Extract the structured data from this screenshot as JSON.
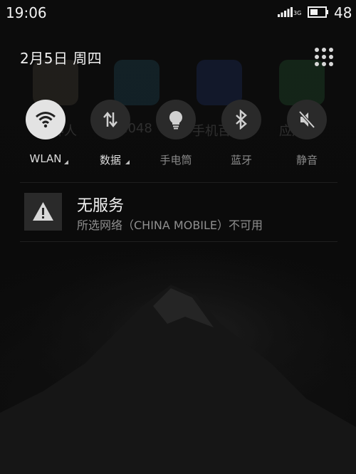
{
  "status_bar": {
    "time": "19:06",
    "network_type": "3G",
    "battery_level": "48"
  },
  "header": {
    "date": "2月5日  周四",
    "grid_icon": "app-grid-icon"
  },
  "background_apps": [
    {
      "label": "神人",
      "color": "#8a7a6a"
    },
    {
      "label": "2048",
      "color": "#3b8db0"
    },
    {
      "label": "手机百度",
      "color": "#2f54c8"
    },
    {
      "label": "应用宝",
      "color": "#3ea65a"
    }
  ],
  "toggles": [
    {
      "label": "WLAN",
      "icon": "wifi-icon",
      "state": "on",
      "has_menu": true
    },
    {
      "label": "数据",
      "icon": "data-arrows-icon",
      "state": "off",
      "has_menu": true
    },
    {
      "label": "手电筒",
      "icon": "flashlight-bulb-icon",
      "state": "off",
      "has_menu": false
    },
    {
      "label": "蓝牙",
      "icon": "bluetooth-icon",
      "state": "off",
      "has_menu": false
    },
    {
      "label": "静音",
      "icon": "mute-icon",
      "state": "off",
      "has_menu": false
    }
  ],
  "notification": {
    "icon": "warning-icon",
    "title": "无服务",
    "body": "所选网络（CHINA MOBILE）不可用"
  },
  "colors": {
    "background": "#0b0b0b",
    "toggle_on": "#e3e3e3",
    "toggle_off": "#2a2a2a",
    "text_primary": "#f2f2f2",
    "text_secondary": "#8f8f8f"
  }
}
